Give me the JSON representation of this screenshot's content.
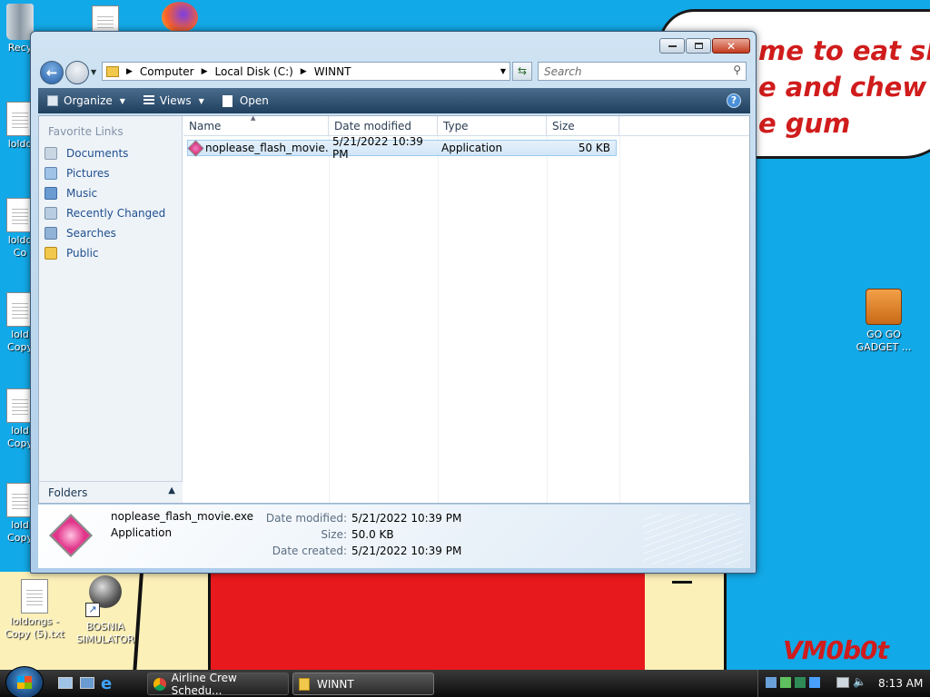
{
  "desktop": {
    "icons": {
      "recycle": "Recy",
      "i1": "loldo",
      "i2a": "loldo",
      "i2b": "Co",
      "i3a": "lold",
      "i3b": "Copy",
      "i4a": "lold",
      "i4b": "Copy",
      "i5a": "lold",
      "i5b": "Copy",
      "txt_a": "loldongs -",
      "txt_b": "Copy (5).txt",
      "bosnia_a": "BOSNIA",
      "bosnia_b": "SIMULATOR",
      "gadget_a": "GO GO",
      "gadget_b": "GADGET ..."
    },
    "wallpaper": {
      "line1": "me to eat shit",
      "line2": "e and chew",
      "line3": "e gum",
      "signature": "VM0b0t"
    }
  },
  "window": {
    "address": {
      "seg1": "Computer",
      "seg2": "Local Disk (C:)",
      "seg3": "WINNT"
    },
    "search_placeholder": "Search",
    "toolbar": {
      "organize": "Organize",
      "views": "Views",
      "open": "Open"
    },
    "nav": {
      "header": "Favorite Links",
      "items": [
        "Documents",
        "Pictures",
        "Music",
        "Recently Changed",
        "Searches",
        "Public"
      ],
      "folders": "Folders"
    },
    "columns": {
      "name": "Name",
      "date": "Date modified",
      "type": "Type",
      "size": "Size"
    },
    "file": {
      "name": "noplease_flash_movie....",
      "date": "5/21/2022 10:39 PM",
      "type": "Application",
      "size": "50 KB"
    },
    "details": {
      "filename": "noplease_flash_movie.exe",
      "type": "Application",
      "date_modified_label": "Date modified:",
      "date_modified": "5/21/2022 10:39 PM",
      "size_label": "Size:",
      "size": "50.0 KB",
      "date_created_label": "Date created:",
      "date_created": "5/21/2022 10:39 PM"
    }
  },
  "taskbar": {
    "tasks": [
      "Airline Crew Schedu...",
      "WINNT"
    ],
    "clock": "8:13 AM"
  },
  "colors": {
    "desktop": "#12a9e8",
    "accent_text": "#d01c1c"
  }
}
